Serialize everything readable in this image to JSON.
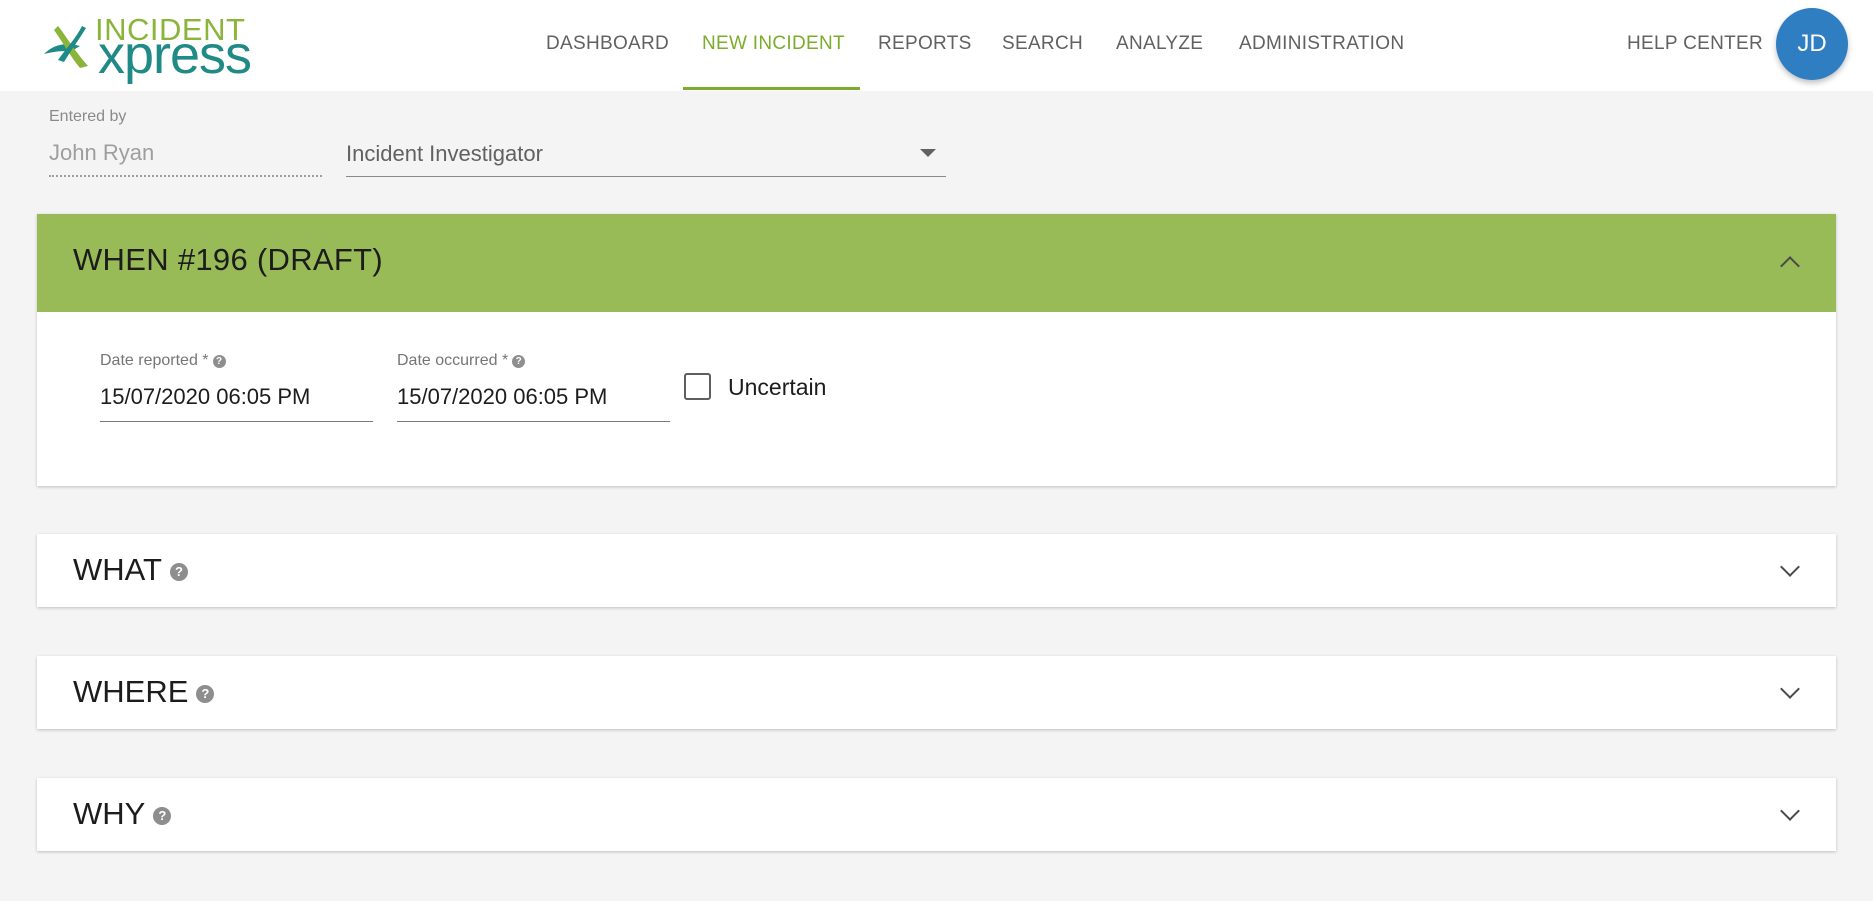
{
  "app": {
    "logo_top": "INCIDENT",
    "logo_bottom": "xpress"
  },
  "nav": {
    "items": [
      {
        "label": "DASHBOARD"
      },
      {
        "label": "NEW INCIDENT"
      },
      {
        "label": "REPORTS"
      },
      {
        "label": "SEARCH"
      },
      {
        "label": "ANALYZE"
      },
      {
        "label": "ADMINISTRATION"
      }
    ],
    "active": "NEW INCIDENT",
    "help_label": "HELP CENTER",
    "avatar_initials": "JD",
    "accent_color": "#7cac2c",
    "avatar_color": "#2f7ec1"
  },
  "entered_by": {
    "label": "Entered by",
    "value": "John Ryan",
    "role_value": "Incident Investigator"
  },
  "when": {
    "title": "WHEN #196 (DRAFT)",
    "header_color": "#98bb57",
    "date_reported_label": "Date reported *",
    "date_reported_value": "15/07/2020 06:05 PM",
    "date_occurred_label": "Date occurred *",
    "date_occurred_value": "15/07/2020 06:05 PM",
    "uncertain_label": "Uncertain",
    "uncertain_checked": false
  },
  "sections": [
    {
      "title": "WHAT"
    },
    {
      "title": "WHERE"
    },
    {
      "title": "WHY"
    }
  ],
  "icons": {
    "help": "help-circle-icon",
    "collapse": "chevron-up-icon",
    "expand": "chevron-down-icon",
    "select_caret": "caret-down-icon"
  }
}
